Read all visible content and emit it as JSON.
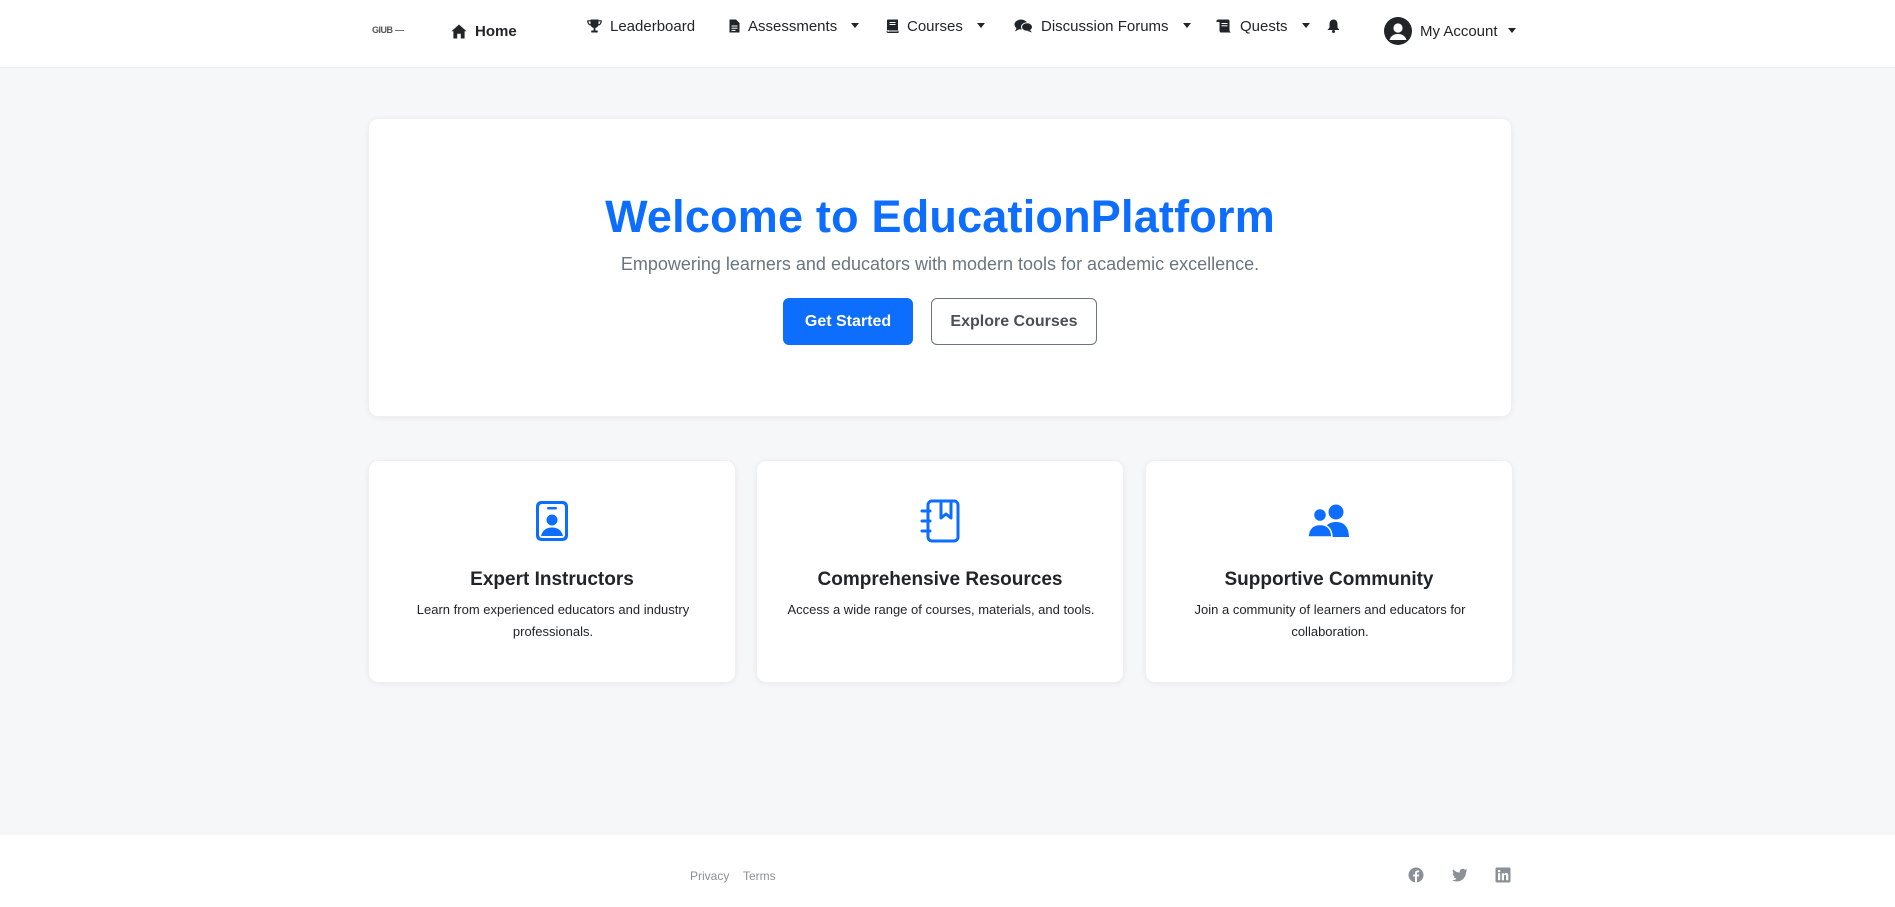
{
  "navbar": {
    "logo_text": "GIUB",
    "items": [
      {
        "label": "Home",
        "icon": "home-icon"
      },
      {
        "label": "Leaderboard",
        "icon": "trophy-icon"
      },
      {
        "label": "Assessments",
        "icon": "file-icon"
      },
      {
        "label": "Courses",
        "icon": "book-icon"
      },
      {
        "label": "Discussion Forums",
        "icon": "comments-icon"
      },
      {
        "label": "Quests",
        "icon": "scroll-icon"
      }
    ],
    "notifications_icon": "bell-icon",
    "account_label": "My Account"
  },
  "hero": {
    "title": "Welcome to EducationPlatform",
    "subtitle": "Empowering learners and educators with modern tools for academic excellence.",
    "primary_button": "Get Started",
    "secondary_button": "Explore Courses"
  },
  "features": [
    {
      "icon": "id-badge-icon",
      "title": "Expert Instructors",
      "text": "Learn from experienced educators and industry professionals."
    },
    {
      "icon": "journal-bookmark-icon",
      "title": "Comprehensive Resources",
      "text": "Access a wide range of courses, materials, and tools."
    },
    {
      "icon": "people-icon",
      "title": "Supportive Community",
      "text": "Join a community of learners and educators for collaboration."
    }
  ],
  "footer": {
    "links": [
      "Privacy",
      "Terms"
    ],
    "social": [
      "facebook-icon",
      "twitter-icon",
      "linkedin-icon"
    ]
  },
  "colors": {
    "primary": "#0d6efd",
    "background": "#f6f7f9",
    "text": "#212529",
    "muted": "#6c757d"
  }
}
